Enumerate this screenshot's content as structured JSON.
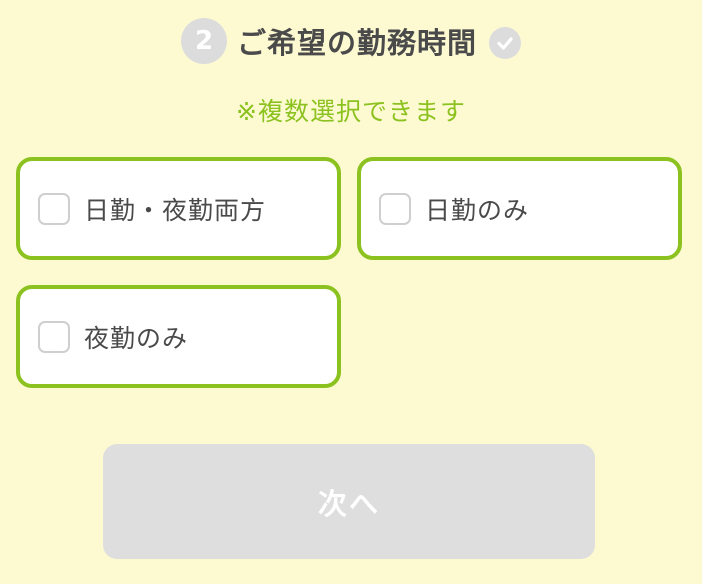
{
  "header": {
    "step_number": "2",
    "title": "ご希望の勤務時間",
    "status_icon": "check-circle-icon"
  },
  "note": "※複数選択できます",
  "options": [
    {
      "label": "日勤・夜勤両方",
      "checked": false
    },
    {
      "label": "日勤のみ",
      "checked": false
    },
    {
      "label": "夜勤のみ",
      "checked": false
    }
  ],
  "next_button": {
    "label": "次へ",
    "enabled": false
  },
  "colors": {
    "background": "#fdfad2",
    "accent": "#8cc21f",
    "text": "#4a4a4a",
    "disabled": "#dedede"
  }
}
